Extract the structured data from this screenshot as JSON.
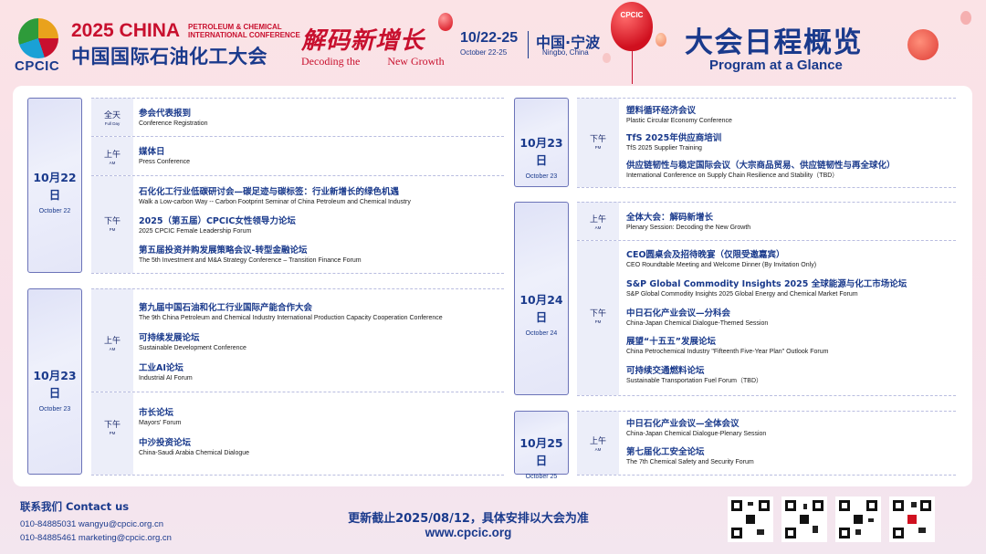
{
  "header": {
    "logo_text": "CPCIC",
    "title_year": "2025 CHINA",
    "title_sub_1": "PETROLEUM & CHEMICAL",
    "title_sub_2": "INTERNATIONAL CONFERENCE",
    "title_cn": "中国国际石油化工大会",
    "slogan_cn": "解码新增长",
    "slogan_en_1": "Decoding the",
    "slogan_en_2": "New Growth",
    "dates": "10/22-25",
    "dates_en": "October 22-25",
    "city_cn": "中国·宁波",
    "city_en": "Ningbo, China",
    "balloon_label": "CPCIC",
    "agenda_cn": "大会日程概览",
    "agenda_en": "Program at a Glance"
  },
  "left": {
    "day1": {
      "date_cn": "10月22日",
      "date_en": "October 22"
    },
    "day2": {
      "date_cn": "10月23日",
      "date_en": "October 23"
    },
    "slots": {
      "fullday": {
        "cn": "全天",
        "en": "Full Day"
      },
      "am1": {
        "cn": "上午",
        "en": "AM"
      },
      "pm1": {
        "cn": "下午",
        "en": "PM"
      },
      "am2": {
        "cn": "上午",
        "en": "AM"
      },
      "pm2": {
        "cn": "下午",
        "en": "PM"
      }
    },
    "events": [
      {
        "cn": "参会代表报到",
        "en": "Conference Registration"
      },
      {
        "cn": "媒体日",
        "en": "Press Conference"
      },
      {
        "cn": "石化化工行业低碳研讨会—碳足迹与碳标签：行业新增长的绿色机遇",
        "en": "Walk a Low-carbon Way -- Carbon Footprint Seminar of China Petroleum and Chemical Industry"
      },
      {
        "cn": "2025（第五届）CPCIC女性领导力论坛",
        "en": "2025 CPCIC Female Leadership Forum"
      },
      {
        "cn": "第五届投资并购发展策略会议-转型金融论坛",
        "en": "The 5th Investment and M&A Strategy Conference – Transition Finance Forum"
      },
      {
        "cn": "第九届中国石油和化工行业国际产能合作大会",
        "en": "The 9th China Petroleum and Chemical Industry International Production Capacity Cooperation Conference"
      },
      {
        "cn": "可持续发展论坛",
        "en": "Sustainable Development Conference"
      },
      {
        "cn": "工业AI论坛",
        "en": "Industrial AI Forum"
      },
      {
        "cn": "市长论坛",
        "en": "Mayors' Forum"
      },
      {
        "cn": "中沙投资论坛",
        "en": "China-Saudi Arabia Chemical Dialogue"
      }
    ]
  },
  "right": {
    "day2": {
      "date_cn": "10月23日",
      "date_en": "October 23"
    },
    "day3": {
      "date_cn": "10月24日",
      "date_en": "October 24"
    },
    "day4": {
      "date_cn": "10月25日",
      "date_en": "October 25"
    },
    "slots": {
      "pm23": {
        "cn": "下午",
        "en": "PM"
      },
      "am24": {
        "cn": "上午",
        "en": "AM"
      },
      "pm24": {
        "cn": "下午",
        "en": "PM"
      },
      "am25": {
        "cn": "上午",
        "en": "AM"
      }
    },
    "events": [
      {
        "cn": "塑料循环经济会议",
        "en": "Plastic Circular Economy Conference"
      },
      {
        "cn": "TfS 2025年供应商培训",
        "en": "TfS 2025 Supplier Training"
      },
      {
        "cn": "供应链韧性与稳定国际会议（大宗商品贸易、供应链韧性与再全球化）",
        "en": "International Conference on Supply Chain Resilience and Stability（TBD）"
      },
      {
        "cn": "全体大会：解码新增长",
        "en": "Plenary Session: Decoding the New Growth"
      },
      {
        "cn": "CEO圆桌会及招待晚宴（仅限受邀嘉宾）",
        "en": "CEO Roundtable Meeting and Welcome Dinner (By Invitation Only)"
      },
      {
        "cn": "S&P Global Commodity Insights 2025 全球能源与化工市场论坛",
        "en": "S&P Global Commodity Insights 2025 Global Energy and Chemical Market Forum"
      },
      {
        "cn": "中日石化产业会议—分科会",
        "en": "China-Japan Chemical Dialogue-Themed Session"
      },
      {
        "cn": "展望“十五五”发展论坛",
        "en": "China Petrochemical Industry \"Fifteenth Five-Year Plan\" Outlook Forum"
      },
      {
        "cn": "可持续交通燃料论坛",
        "en": "Sustainable Transportation Fuel Forum（TBD）"
      },
      {
        "cn": "中日石化产业会议—全体会议",
        "en": "China-Japan Chemical Dialogue-Plenary Session"
      },
      {
        "cn": "第七届化工安全论坛",
        "en": "The 7th Chemical Safety and Security Forum"
      }
    ]
  },
  "footer": {
    "contact_title": "联系我们 Contact us",
    "line1": "010-84885031  wangyu@cpcic.org.cn",
    "line2": "010-84885461  marketing@cpcic.org.cn",
    "update": "更新截止2025/08/12，具体安排以大会为准",
    "url": "www.cpcic.org"
  }
}
